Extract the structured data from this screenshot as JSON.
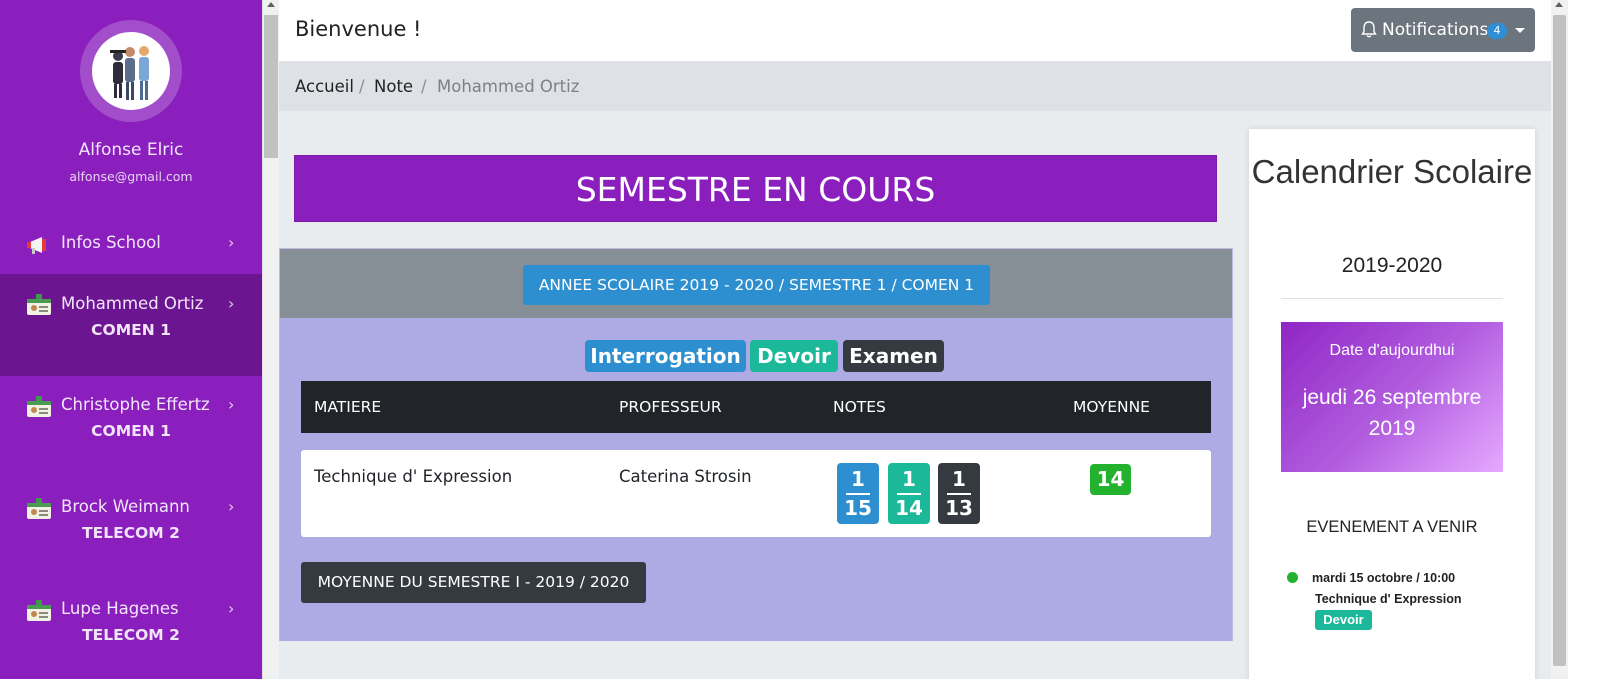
{
  "sidebar": {
    "user_name": "Alfonse Elric",
    "user_email": "alfonse@gmail.com",
    "items": [
      {
        "label": "Infos School",
        "sub": "",
        "icon": "megaphone-icon",
        "active": false
      },
      {
        "label": "Mohammed Ortiz",
        "sub": "COMEN 1",
        "icon": "id-card-icon",
        "active": true
      },
      {
        "label": "Christophe Effertz",
        "sub": "COMEN 1",
        "icon": "id-card-icon",
        "active": false
      },
      {
        "label": "Brock Weimann",
        "sub": "TELECOM 2",
        "icon": "id-card-icon",
        "active": false
      },
      {
        "label": "Lupe Hagenes",
        "sub": "TELECOM 2",
        "icon": "id-card-icon",
        "active": false
      }
    ]
  },
  "header": {
    "welcome": "Bienvenue !",
    "notifications_label": "Notifications",
    "notifications_count": "4"
  },
  "breadcrumb": {
    "items": [
      "Accueil",
      "Note",
      "Mohammed Ortiz"
    ],
    "separator": "/"
  },
  "main": {
    "semester_title": "SEMESTRE EN COURS",
    "year_button": "ANNEE SCOLAIRE 2019 - 2020 / SEMESTRE 1 / COMEN 1",
    "legend": {
      "interrogation": "Interrogation",
      "devoir": "Devoir",
      "examen": "Examen"
    },
    "table": {
      "headers": [
        "MATIERE",
        "PROFESSEUR",
        "NOTES",
        "MOYENNE"
      ],
      "rows": [
        {
          "matiere": "Technique d' Expression",
          "professeur": "Caterina Strosin",
          "notes": [
            {
              "type": "interrogation",
              "num": "1",
              "den": "15"
            },
            {
              "type": "devoir",
              "num": "1",
              "den": "14"
            },
            {
              "type": "examen",
              "num": "1",
              "den": "13"
            }
          ],
          "moyenne": "14"
        }
      ]
    },
    "semester_average_button": "MOYENNE DU SEMESTRE I - 2019 / 2020"
  },
  "calendar": {
    "title": "Calendrier Scolaire",
    "year": "2019-2020",
    "today_label": "Date d'aujourdhui",
    "today_date": "jeudi 26 septembre 2019",
    "upcoming_title": "EVENEMENT A VENIR",
    "events": [
      {
        "when": "mardi 15 octobre / 10:00",
        "subject": "Technique d' Expression",
        "badge": "Devoir"
      }
    ]
  },
  "colors": {
    "sidebar": "#8a1fbd",
    "sidebar_active": "#6b1690",
    "interrogation": "#2d8fd0",
    "devoir": "#1bb89a",
    "examen": "#343a40",
    "average": "#22b22e",
    "card_body": "#aeaae3"
  }
}
